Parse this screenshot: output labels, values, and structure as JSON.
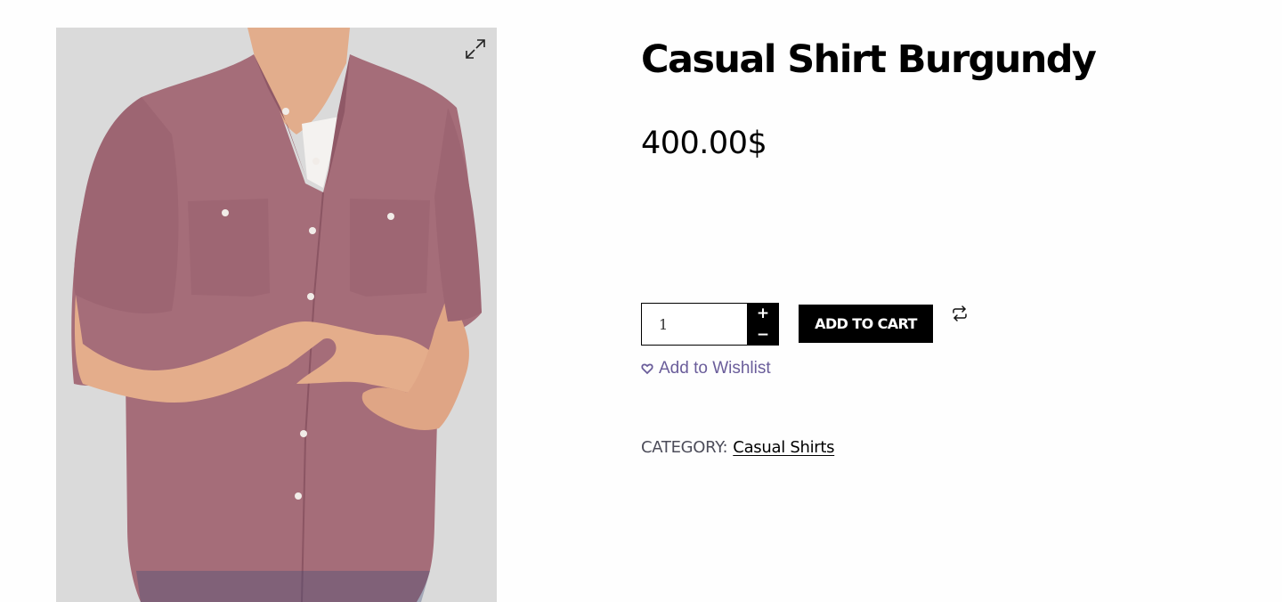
{
  "product": {
    "title": "Casual Shirt Burgundy",
    "price": "400.00$",
    "image": {
      "description_icon": "product-photo",
      "background_color": "#dadada",
      "shirt_color": "#a56d79"
    }
  },
  "cart_form": {
    "quantity_value": "1",
    "increment_label": "+",
    "decrement_label": "−",
    "add_to_cart_label": "ADD TO CART"
  },
  "icons": {
    "zoom": "expand-icon",
    "compare": "compare-icon",
    "wishlist": "heart-icon"
  },
  "wishlist": {
    "label": "Add to Wishlist",
    "color": "#6a5d9a"
  },
  "meta": {
    "category_label": "CATEGORY:",
    "category_value": "Casual Shirts"
  }
}
